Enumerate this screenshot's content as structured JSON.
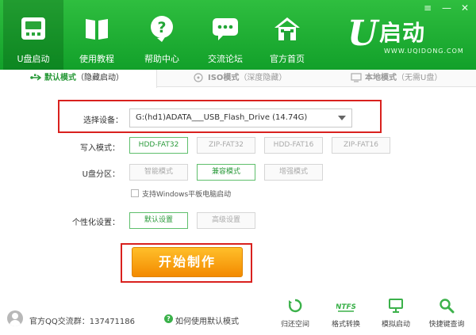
{
  "header": {
    "nav": [
      {
        "label": "U盘启动",
        "icon": "usb-drive-icon",
        "active": true
      },
      {
        "label": "使用教程",
        "icon": "book-icon",
        "active": false
      },
      {
        "label": "帮助中心",
        "icon": "help-icon",
        "active": false
      },
      {
        "label": "交流论坛",
        "icon": "chat-bubble-icon",
        "active": false
      },
      {
        "label": "官方首页",
        "icon": "home-icon",
        "active": false
      }
    ],
    "logo": {
      "letter": "U",
      "name": "启动",
      "url": "WWW.UQIDONG.COM"
    },
    "window_controls": {
      "menu": "≡",
      "minimize": "—",
      "close": "✕"
    }
  },
  "tabs": [
    {
      "main": "默认模式",
      "sub": "（隐藏启动）",
      "icon": "usb-plug-icon",
      "active": true
    },
    {
      "main": "ISO模式",
      "sub": "（深度隐藏）",
      "icon": "disc-icon",
      "active": false
    },
    {
      "main": "本地模式",
      "sub": "（无需U盘）",
      "icon": "monitor-icon",
      "active": false
    }
  ],
  "form": {
    "device_label": "选择设备：",
    "device_value": "G:(hd1)ADATA___USB_Flash_Drive (14.74G)",
    "write_mode_label": "写入模式：",
    "write_modes": [
      {
        "label": "HDD-FAT32",
        "selected": true
      },
      {
        "label": "ZIP-FAT32",
        "selected": false
      },
      {
        "label": "HDD-FAT16",
        "selected": false
      },
      {
        "label": "ZIP-FAT16",
        "selected": false
      }
    ],
    "partition_label": "U盘分区：",
    "partition_modes": [
      {
        "label": "智能模式",
        "selected": false
      },
      {
        "label": "兼容模式",
        "selected": true
      },
      {
        "label": "增强模式",
        "selected": false
      }
    ],
    "tablet_checkbox_label": "支持Windows平板电脑启动",
    "tablet_checked": false,
    "personal_label": "个性化设置：",
    "personal_options": [
      {
        "label": "默认设置",
        "selected": true
      },
      {
        "label": "高级设置",
        "selected": false
      }
    ],
    "start_button": "开始制作"
  },
  "footer": {
    "qq_group": "官方QQ交流群：137471186",
    "help_link": "如何使用默认模式",
    "tools": [
      {
        "label": "归还空间",
        "icon": "restore-icon"
      },
      {
        "label": "格式转换",
        "icon": "ntfs-icon",
        "icon_text": "NTFS"
      },
      {
        "label": "模拟启动",
        "icon": "monitor-icon"
      },
      {
        "label": "快捷键查询",
        "icon": "search-icon"
      }
    ]
  },
  "colors": {
    "header_green": "#1aaa30",
    "accent_green": "#2a9a3a",
    "start_orange": "#f59a10",
    "highlight_red": "#d9211e"
  }
}
